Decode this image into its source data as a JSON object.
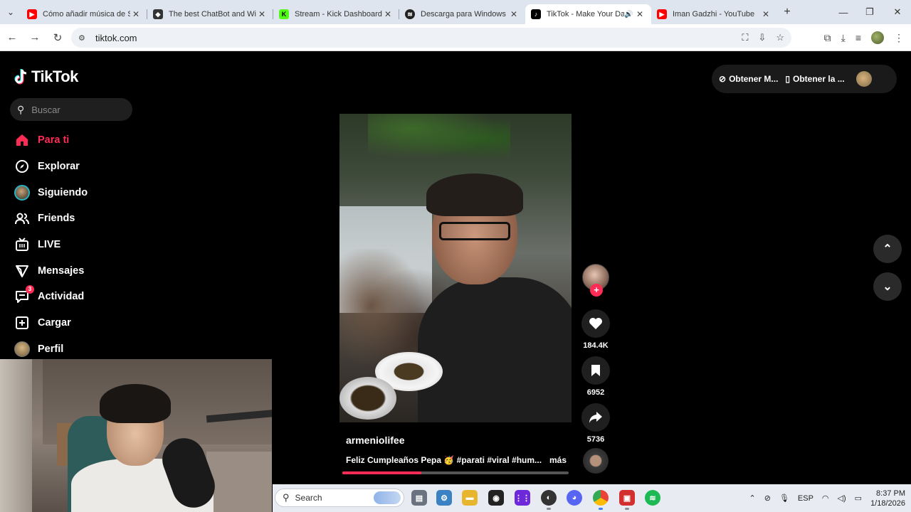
{
  "browser": {
    "tabs": [
      {
        "label": "Cómo añadir música de Sp",
        "favicon_color": "#ff0000",
        "active": false
      },
      {
        "label": "The best ChatBot and Wid",
        "favicon_color": "#333333",
        "active": false
      },
      {
        "label": "Stream - Kick Dashboard",
        "favicon_color": "#53fc18",
        "active": false
      },
      {
        "label": "Descarga para Windows -",
        "favicon_color": "#222222",
        "active": false
      },
      {
        "label": "TikTok - Make Your Da",
        "favicon_color": "#000000",
        "active": true
      },
      {
        "label": "Iman Gadzhi - YouTube",
        "favicon_color": "#ff0000",
        "active": false
      }
    ],
    "url": "tiktok.com"
  },
  "tiktok": {
    "logo_text": "TikTok",
    "search_placeholder": "Buscar",
    "nav": [
      {
        "label": "Para ti",
        "icon": "home-icon",
        "active": true
      },
      {
        "label": "Explorar",
        "icon": "compass-icon"
      },
      {
        "label": "Siguiendo",
        "icon": "avatar-icon"
      },
      {
        "label": "Friends",
        "icon": "friends-icon"
      },
      {
        "label": "LIVE",
        "icon": "live-icon"
      },
      {
        "label": "Mensajes",
        "icon": "send-icon"
      },
      {
        "label": "Actividad",
        "icon": "activity-icon",
        "badge": "3"
      },
      {
        "label": "Cargar",
        "icon": "plus-square-icon"
      },
      {
        "label": "Perfil",
        "icon": "profile-avatar-icon"
      }
    ],
    "top_right": {
      "get_coins": "Obtener M...",
      "get_app": "Obtener la ..."
    },
    "video": {
      "author": "armeniolifee",
      "caption": "Feliz Cumpleaños Pepa 🥳 #parati #viral #hum...",
      "more": "más",
      "progress": 0.35,
      "likes": "184.4K",
      "saves": "6952",
      "shares": "5736"
    }
  },
  "taskbar": {
    "search_placeholder": "Search",
    "language": "ESP",
    "time": "8:37 PM",
    "date": "1/18/2026"
  },
  "colors": {
    "accent": "#fe2c55",
    "background": "#000000"
  }
}
